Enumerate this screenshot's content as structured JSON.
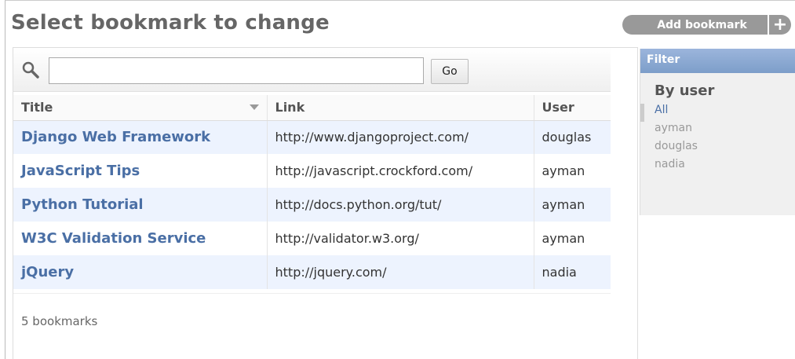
{
  "page": {
    "title": "Select bookmark to change",
    "add_button_label": "Add bookmark"
  },
  "search": {
    "value": "",
    "placeholder": "",
    "go_label": "Go"
  },
  "table": {
    "columns": [
      "Title",
      "Link",
      "User"
    ],
    "rows": [
      {
        "title": "Django Web Framework",
        "link": "http://www.djangoproject.com/",
        "user": "douglas"
      },
      {
        "title": "JavaScript Tips",
        "link": "http://javascript.crockford.com/",
        "user": "ayman"
      },
      {
        "title": "Python Tutorial",
        "link": "http://docs.python.org/tut/",
        "user": "ayman"
      },
      {
        "title": "W3C Validation Service",
        "link": "http://validator.w3.org/",
        "user": "ayman"
      },
      {
        "title": "jQuery",
        "link": "http://jquery.com/",
        "user": "nadia"
      }
    ]
  },
  "paginator": {
    "text": "5 bookmarks"
  },
  "filter": {
    "header": "Filter",
    "subtitle": "By user",
    "options": [
      "All",
      "ayman",
      "douglas",
      "nadia"
    ],
    "selected": "All"
  },
  "colors": {
    "link": "#4a6fa5",
    "row_alt": "#edf3fe",
    "filter_header": "#7d9ec9",
    "button_bg": "#999999"
  },
  "icons": {
    "search": "search-icon",
    "add": "plus-icon",
    "sort": "sort-desc-icon"
  }
}
